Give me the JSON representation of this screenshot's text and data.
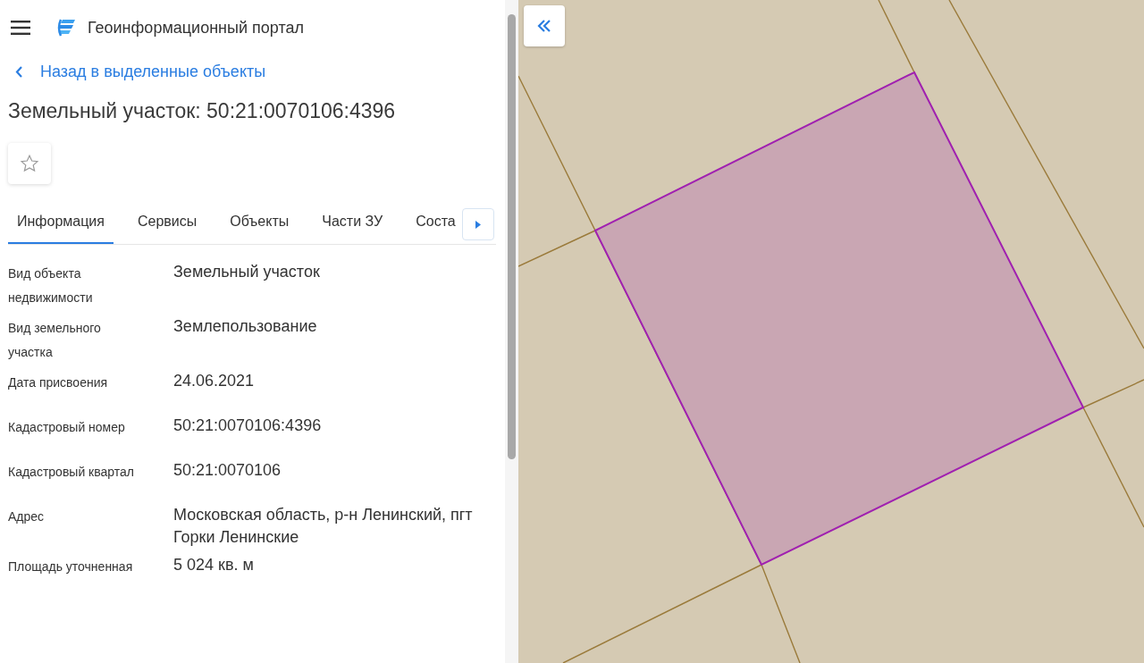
{
  "header": {
    "title": "Геоинформационный портал"
  },
  "back_link": "Назад в выделенные объекты",
  "heading": "Земельный участок: 50:21:0070106:4396",
  "favorite": {
    "selected": false
  },
  "tabs": [
    {
      "label": "Информация",
      "selected": true
    },
    {
      "label": "Сервисы",
      "selected": false
    },
    {
      "label": "Объекты",
      "selected": false
    },
    {
      "label": "Части ЗУ",
      "selected": false
    },
    {
      "label": "Соста",
      "selected": false
    }
  ],
  "properties": [
    {
      "label": "Вид объекта недвижимости",
      "value": "Земельный участок"
    },
    {
      "label": "Вид земельного участка",
      "value": "Землепользование"
    },
    {
      "label": "Дата присвоения",
      "value": "24.06.2021"
    },
    {
      "label": "Кадастровый номер",
      "value": "50:21:0070106:4396"
    },
    {
      "label": "Кадастровый квартал",
      "value": "50:21:0070106"
    },
    {
      "label": "Адрес",
      "value": "Московская область, р-н Ленинский, пгт Горки Ленинские"
    },
    {
      "label": "Площадь уточненная",
      "value": "5 024 кв. м"
    }
  ]
}
